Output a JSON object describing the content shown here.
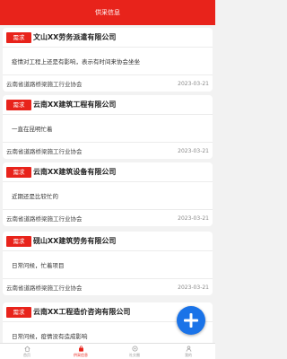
{
  "header": {
    "title": "供采信息"
  },
  "posts": [
    {
      "tag": "需求",
      "company": "文山XX劳务派遣有限公司",
      "content": "疫情对工程上还是有影响，表示有时间来协会坐坐",
      "association": "云南省道路桥梁施工行业协会",
      "date": "2023-03-21"
    },
    {
      "tag": "需求",
      "company": "云南XX建筑工程有限公司",
      "content": "一直在昆明忙着",
      "association": "云南省道路桥梁施工行业协会",
      "date": "2023-03-21"
    },
    {
      "tag": "需求",
      "company": "云南XX建筑设备有限公司",
      "content": "近期还是比较忙的",
      "association": "云南省道路桥梁施工行业协会",
      "date": "2023-03-21"
    },
    {
      "tag": "需求",
      "company": "砚山XX建筑劳务有限公司",
      "content": "日常问候，忙着项目",
      "association": "云南省道路桥梁施工行业协会",
      "date": "2023-03-21"
    },
    {
      "tag": "需求",
      "company": "云南XX工程造价咨询有限公司",
      "content": "日常问候，疫情没有造成影响",
      "association": "",
      "date": ""
    }
  ],
  "fab": {
    "icon": "plus-icon"
  },
  "tabbar": {
    "items": [
      {
        "label": "首页",
        "icon": "home-icon",
        "active": false
      },
      {
        "label": "供采信息",
        "icon": "shopping-bag-icon",
        "active": true
      },
      {
        "label": "社交圈",
        "icon": "community-icon",
        "active": false
      },
      {
        "label": "我的",
        "icon": "user-icon",
        "active": false
      }
    ]
  },
  "colors": {
    "brand": "#e8231b",
    "fab": "#1a73e8",
    "background": "#f2f2f2"
  }
}
